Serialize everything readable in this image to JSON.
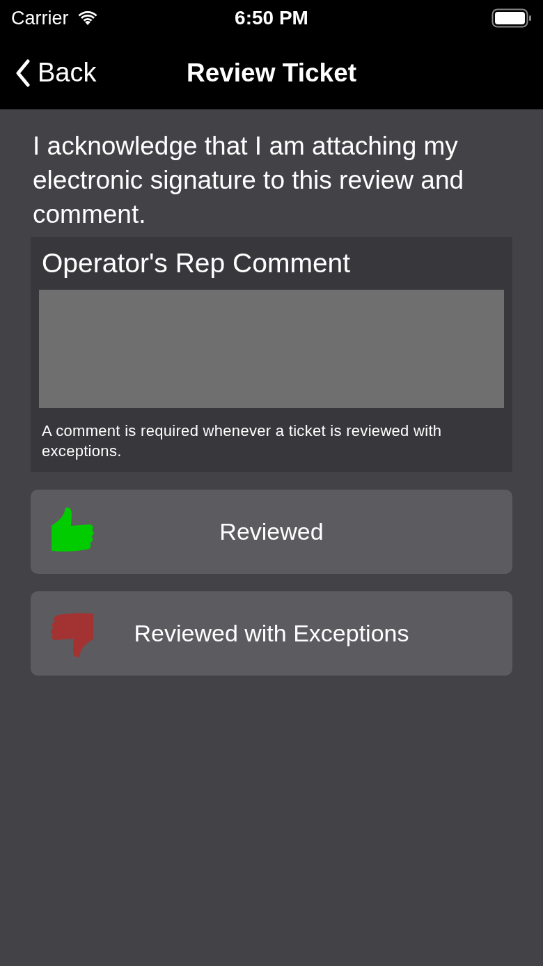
{
  "status_bar": {
    "carrier": "Carrier",
    "time": "6:50 PM"
  },
  "nav": {
    "back": "Back",
    "title": "Review Ticket"
  },
  "statement": "I acknowledge that I am attaching my electronic signature to this review and comment.",
  "comment": {
    "title": "Operator's Rep Comment",
    "helper": "A comment is required whenever a ticket is reviewed with exceptions."
  },
  "buttons": [
    {
      "label": "Reviewed",
      "kind": "thumbs-up",
      "color": "#00cc00"
    },
    {
      "label": "Reviewed with Exceptions",
      "kind": "thumbs-down",
      "color": "#a33333"
    }
  ]
}
